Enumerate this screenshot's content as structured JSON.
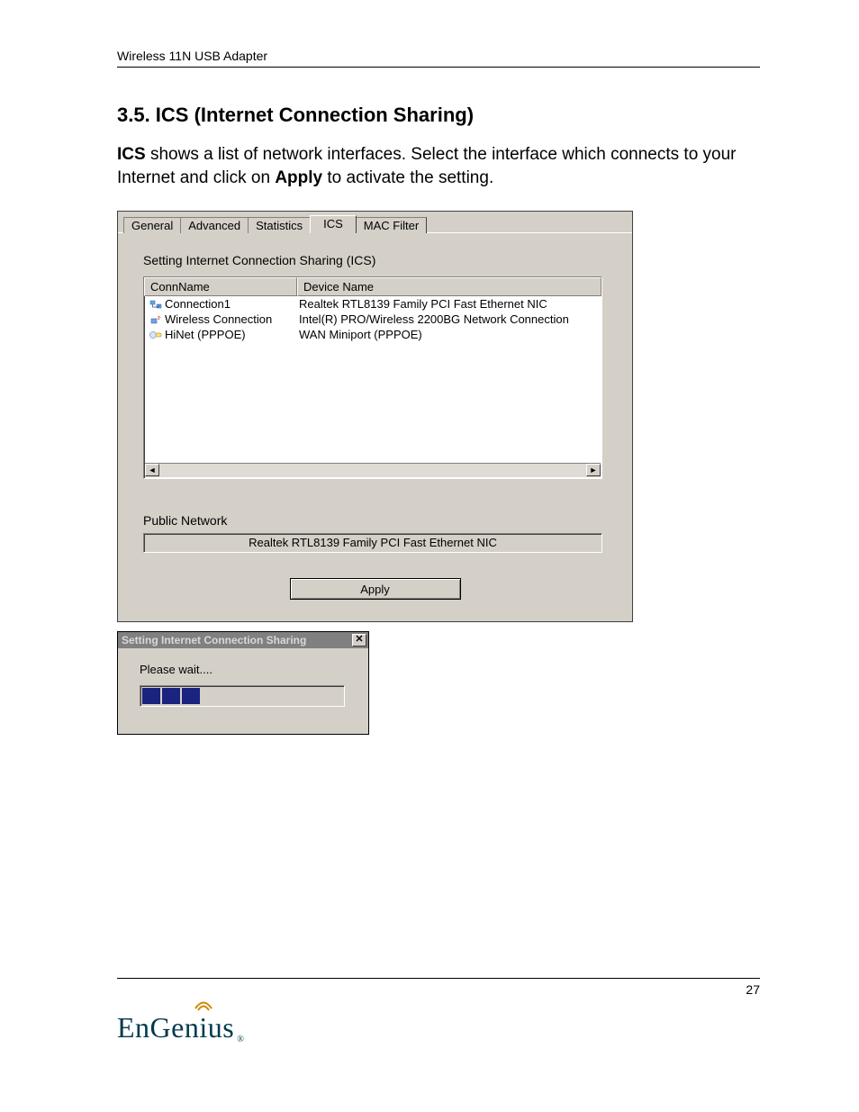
{
  "header": {
    "product": "Wireless 11N USB Adapter"
  },
  "section": {
    "title": "3.5. ICS (Internet Connection Sharing)",
    "intro_strong1": "ICS",
    "intro_part1": " shows a list of network interfaces. Select the interface which connects to your Internet and click on ",
    "intro_strong2": "Apply",
    "intro_part2": " to activate the setting."
  },
  "dialog": {
    "tabs": [
      "General",
      "Advanced",
      "Statistics",
      "ICS",
      "MAC Filter"
    ],
    "active_tab": "ICS",
    "groupbox_label": "Setting Internet Connection Sharing (ICS)",
    "columns": {
      "c1": "ConnName",
      "c2": "Device Name"
    },
    "rows": [
      {
        "conn": "Connection1",
        "device": "Realtek RTL8139 Family PCI Fast Ethernet NIC"
      },
      {
        "conn": "Wireless Connection",
        "device": "Intel(R) PRO/Wireless 2200BG Network Connection"
      },
      {
        "conn": "HiNet (PPPOE)",
        "device": "WAN Miniport (PPPOE)"
      }
    ],
    "public_label": "Public Network",
    "public_value": "Realtek RTL8139 Family PCI Fast Ethernet NIC",
    "apply_label": "Apply"
  },
  "progress": {
    "title": "Setting Internet Connection Sharing",
    "wait": "Please wait....",
    "blocks": 3
  },
  "footer": {
    "page": "27",
    "brand": "EnGenius"
  }
}
